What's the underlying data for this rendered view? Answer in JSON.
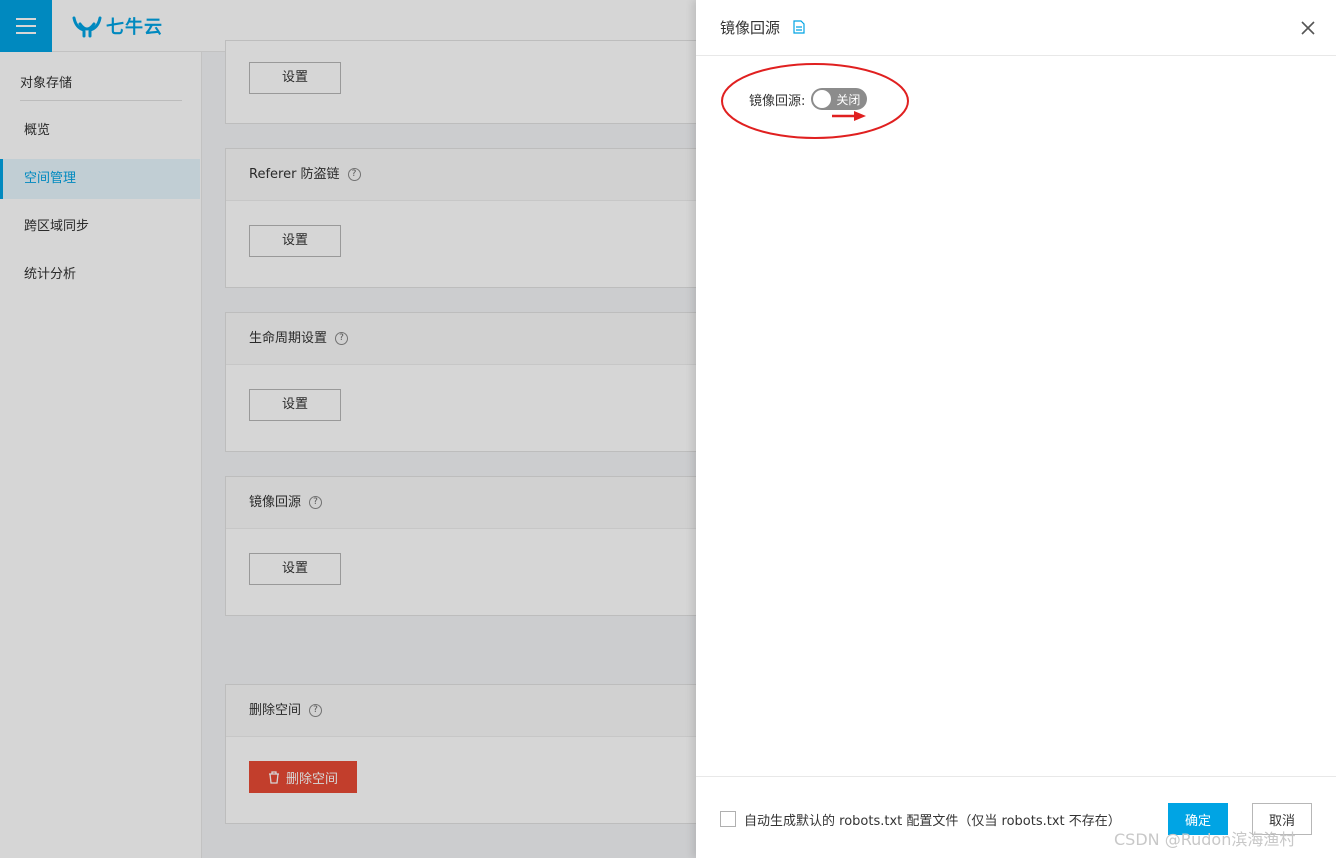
{
  "brand": {
    "logo_text": "七牛云"
  },
  "sidebar": {
    "title": "对象存储",
    "items": [
      {
        "label": "概览"
      },
      {
        "label": "空间管理",
        "active": true
      },
      {
        "label": "跨区域同步"
      },
      {
        "label": "统计分析"
      }
    ]
  },
  "cards": {
    "top": {
      "button": "设置"
    },
    "referer": {
      "title": "Referer 防盗链",
      "button": "设置"
    },
    "lifecycle": {
      "title": "生命周期设置",
      "button": "设置"
    },
    "mirror": {
      "title": "镜像回源",
      "button": "设置"
    },
    "delete": {
      "title": "删除空间",
      "button": "删除空间"
    }
  },
  "drawer": {
    "title": "镜像回源",
    "toggle_label": "镜像回源:",
    "toggle_state": "关闭",
    "checkbox_label": "自动生成默认的 robots.txt 配置文件（仅当 robots.txt 不存在）",
    "ok_label": "确定",
    "cancel_label": "取消"
  },
  "watermark": "CSDN @Rudon滨海渔村",
  "colors": {
    "accent": "#00a4e4",
    "danger": "#e84a35",
    "annotation": "#e02020"
  }
}
